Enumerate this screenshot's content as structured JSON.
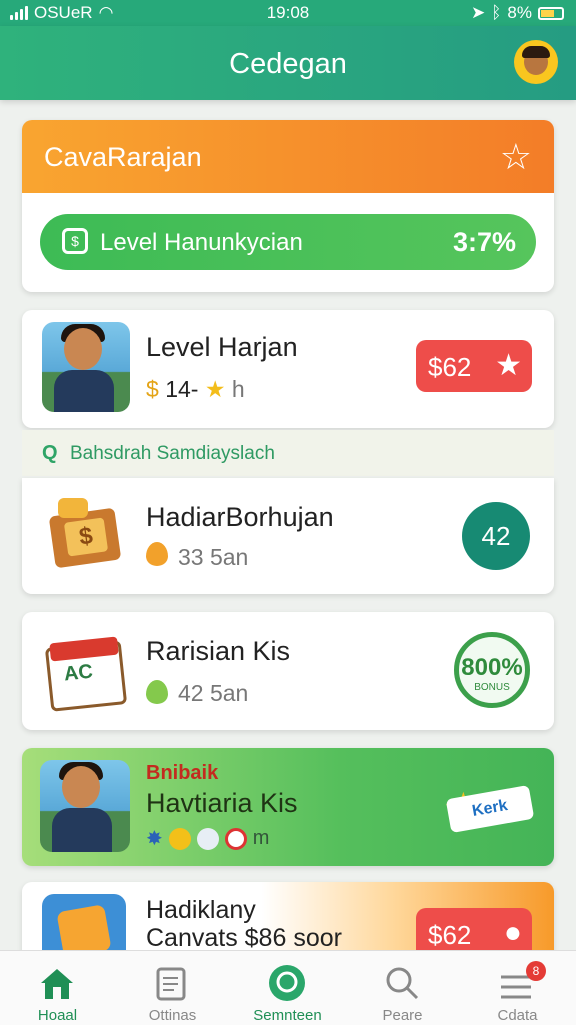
{
  "status": {
    "carrier": "OSUeR",
    "time": "19:08",
    "battery": "8%"
  },
  "header": {
    "title": "Cedegan"
  },
  "hero": {
    "title": "CavaRarajan",
    "progress_label": "Level Hanunkycian",
    "progress_value": "3:7%"
  },
  "rows": [
    {
      "title": "Level Harjan",
      "sub": "14-",
      "unit": "h",
      "badge": "$62"
    },
    {
      "title": "HadiarBorhujan",
      "sub": "33 5an",
      "badge": "42"
    },
    {
      "title": "Rarisian Kis",
      "sub": "42 5an",
      "badge_big": "800%",
      "badge_small": "BONUS"
    }
  ],
  "section_label": "Bahsdrah Samdiayslach",
  "promo": {
    "kicker": "Bnibaik",
    "title": "Havtiaria Kis",
    "trail": "m",
    "tag": "Kerk"
  },
  "row5": {
    "title": "Hadiklany",
    "title2": "Canvats $86 soor",
    "badge": "$62"
  },
  "tabs": [
    {
      "label": "Hoaal",
      "icon": "home-icon"
    },
    {
      "label": "Ottinas",
      "icon": "notes-icon"
    },
    {
      "label": "Semnteen",
      "icon": "chat-icon"
    },
    {
      "label": "Peare",
      "icon": "search-icon"
    },
    {
      "label": "Cdata",
      "icon": "menu-icon",
      "badge": "8"
    }
  ],
  "colors": {
    "primary": "#27a97a",
    "accent": "#f37d28",
    "success": "#3dbb55",
    "danger": "#ee4d4a"
  }
}
